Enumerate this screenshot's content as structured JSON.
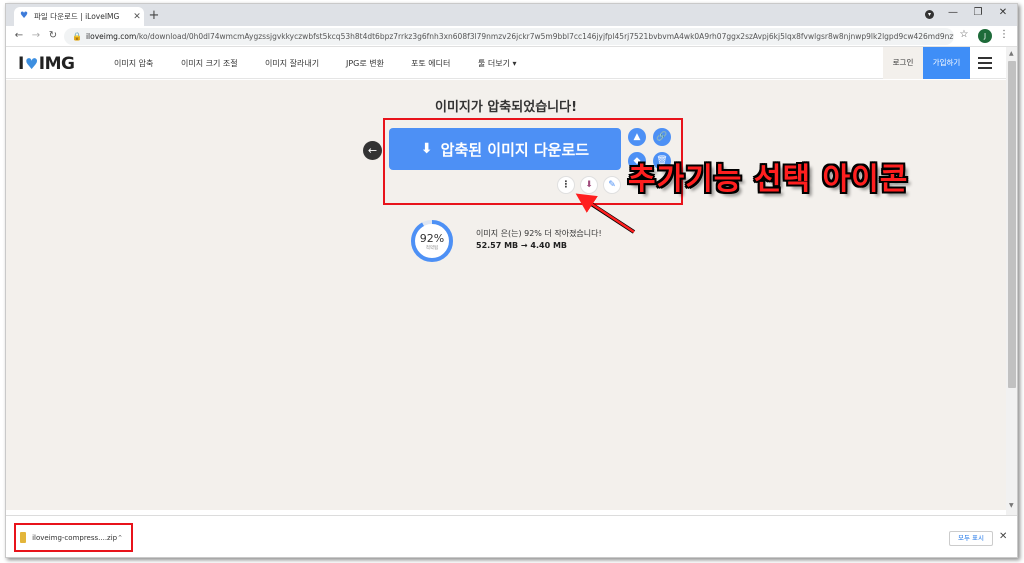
{
  "browser": {
    "tab_title": "파일 다운로드 | iLoveIMG",
    "url_domain": "iloveimg.com",
    "url_path": "/ko/download/0h0dl74wmcmAygzssjgvkkyczwbfst5kcq53h8t4dt6bpz7rrkz3g6fnh3xn608f3l79nmzv26jckr7w5m9bbl7cc146jyjfpl45rj7521bvbvmA4wk0A9rh07ggx2szAvpj6kj5lqx8fvwlgsr8w8njnwp9lk2lgpd9cw426md9nz9jcrl0rq/2",
    "profile_initial": "J"
  },
  "site": {
    "logo_left": "I",
    "logo_right": "IMG",
    "nav": [
      "이미지 압축",
      "이미지 크기 조절",
      "이미지 잘라내기",
      "JPG로 변환",
      "포토 에디터",
      "툴 더보기 ▾"
    ],
    "login": "로그인",
    "signup": "가입하기"
  },
  "main": {
    "title": "이미지가 압축되었습니다!",
    "download_label": "압축된 이미지 다운로드",
    "percent_label": "92%",
    "percent_value": 0.92,
    "percent_sub": "적약됨",
    "saved_message": "이미지 은(는) 92% 더 작아졌습니다!",
    "sizes": "52.57 MB → 4.40 MB"
  },
  "annotation": {
    "callout": "추가기능 선택 아이콘",
    "color": "#ff1f1f"
  },
  "downloads": {
    "file_name": "iloveimg-compress....zip",
    "show_all": "모두 표시"
  },
  "colors": {
    "accent": "#4d90f5",
    "highlight": "#e8131b",
    "background": "#f3f0ec"
  }
}
